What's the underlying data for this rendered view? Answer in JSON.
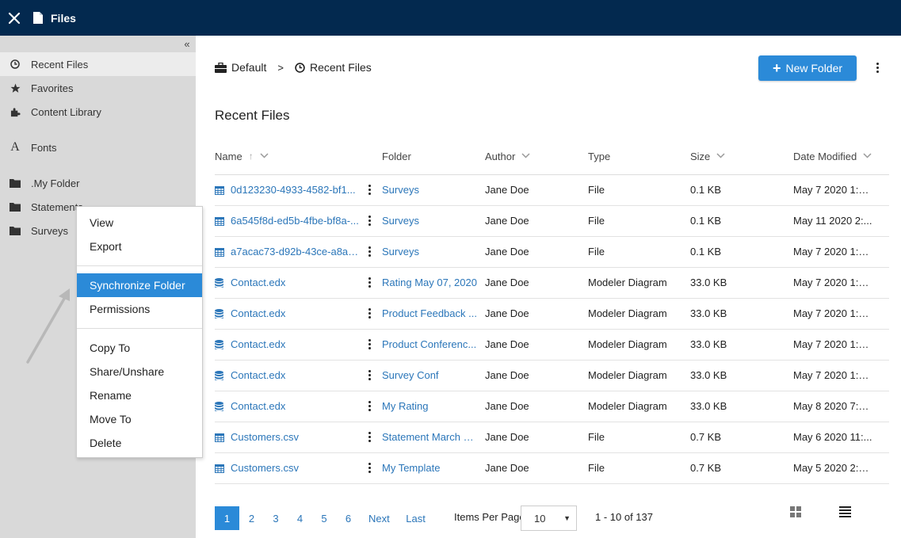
{
  "topbar": {
    "close_icon": "close-icon",
    "file_icon": "file-icon",
    "title": "Files"
  },
  "sidebar": {
    "collapse_glyph": "«",
    "items": [
      {
        "label": "Recent Files",
        "icon": "clock-icon"
      },
      {
        "label": "Favorites",
        "icon": "star-icon"
      },
      {
        "label": "Content Library",
        "icon": "puzzle-icon"
      },
      {
        "label": "Fonts",
        "icon": "font-icon"
      },
      {
        "label": ".My Folder",
        "icon": "folder-icon"
      },
      {
        "label": "Statements",
        "icon": "folder-icon"
      },
      {
        "label": "Surveys",
        "icon": "folder-icon"
      }
    ]
  },
  "breadcrumb": {
    "root": "Default",
    "separator": ">",
    "current": "Recent Files"
  },
  "toolbar": {
    "new_folder_label": "New Folder"
  },
  "section_title": "Recent Files",
  "table": {
    "headers": {
      "name": "Name",
      "folder": "Folder",
      "author": "Author",
      "type": "Type",
      "size": "Size",
      "date": "Date Modified"
    },
    "rows": [
      {
        "icon": "table-icon",
        "name": "0d123230-4933-4582-bf1...",
        "folder": "Surveys",
        "author": "Jane Doe",
        "type": "File",
        "size": "0.1 KB",
        "date": "May 7 2020 1:2..."
      },
      {
        "icon": "table-icon",
        "name": "6a545f8d-ed5b-4fbe-bf8a-...",
        "folder": "Surveys",
        "author": "Jane Doe",
        "type": "File",
        "size": "0.1 KB",
        "date": "May 11 2020 2:..."
      },
      {
        "icon": "table-icon",
        "name": "a7acac73-d92b-43ce-a8a5-...",
        "folder": "Surveys",
        "author": "Jane Doe",
        "type": "File",
        "size": "0.1 KB",
        "date": "May 7 2020 1:5..."
      },
      {
        "icon": "database-icon",
        "name": "Contact.edx",
        "folder": "Rating May 07, 2020",
        "author": "Jane Doe",
        "type": "Modeler Diagram",
        "size": "33.0 KB",
        "date": "May 7 2020 1:1..."
      },
      {
        "icon": "database-icon",
        "name": "Contact.edx",
        "folder": "Product Feedback ...",
        "author": "Jane Doe",
        "type": "Modeler Diagram",
        "size": "33.0 KB",
        "date": "May 7 2020 1:1..."
      },
      {
        "icon": "database-icon",
        "name": "Contact.edx",
        "folder": "Product Conferenc...",
        "author": "Jane Doe",
        "type": "Modeler Diagram",
        "size": "33.0 KB",
        "date": "May 7 2020 1:1..."
      },
      {
        "icon": "database-icon",
        "name": "Contact.edx",
        "folder": "Survey Conf",
        "author": "Jane Doe",
        "type": "Modeler Diagram",
        "size": "33.0 KB",
        "date": "May 7 2020 1:1..."
      },
      {
        "icon": "database-icon",
        "name": "Contact.edx",
        "folder": "My Rating",
        "author": "Jane Doe",
        "type": "Modeler Diagram",
        "size": "33.0 KB",
        "date": "May 8 2020 7:4..."
      },
      {
        "icon": "table-icon",
        "name": "Customers.csv",
        "folder": "Statement March 2...",
        "author": "Jane Doe",
        "type": "File",
        "size": "0.7 KB",
        "date": "May 6 2020 11:..."
      },
      {
        "icon": "table-icon",
        "name": "Customers.csv",
        "folder": "My Template",
        "author": "Jane Doe",
        "type": "File",
        "size": "0.7 KB",
        "date": "May 5 2020 2:0..."
      }
    ]
  },
  "pagination": {
    "pages": [
      "1",
      "2",
      "3",
      "4",
      "5",
      "6"
    ],
    "current_page": "1",
    "next_label": "Next",
    "last_label": "Last",
    "items_per_page_label": "Items Per Page",
    "items_per_page_value": "10",
    "range_text": "1 - 10 of 137"
  },
  "context_menu": {
    "group1": [
      "View",
      "Export"
    ],
    "group2": [
      "Synchronize Folder",
      "Permissions"
    ],
    "group3": [
      "Copy To",
      "Share/Unshare",
      "Rename",
      "Move To",
      "Delete"
    ],
    "selected": "Synchronize Folder"
  },
  "colors": {
    "topbar": "#03294f",
    "accent": "#2b8ad8",
    "link": "#2b76b9",
    "sidebar": "#d9d9d9"
  }
}
